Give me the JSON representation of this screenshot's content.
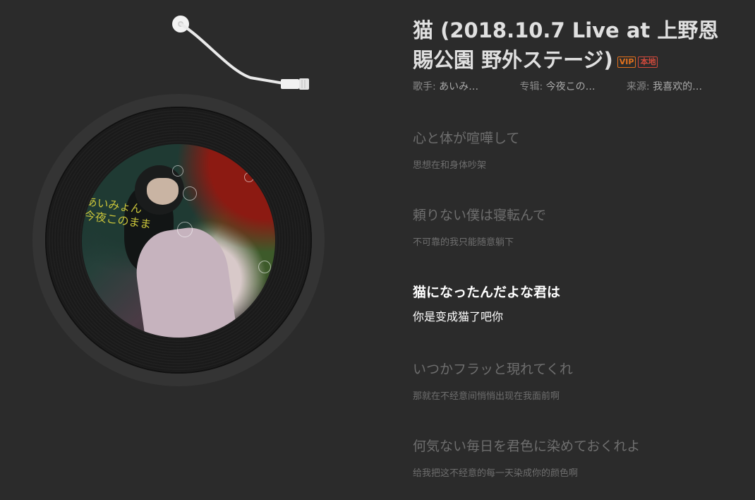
{
  "cover": {
    "caption": "あいみょん\n今夜このまま"
  },
  "song": {
    "title": "猫 (2018.10.7 Live at 上野恩賜公園 野外ステージ)",
    "badges": {
      "vip": "VIP",
      "local": "本地"
    },
    "singer_label": "歌手:",
    "singer": "あいみ…",
    "album_label": "专辑:",
    "album": "今夜この…",
    "source_label": "来源:",
    "source": "我喜欢的…"
  },
  "lyrics": [
    {
      "original": "心と体が喧嘩して",
      "translation": "思想在和身体吵架"
    },
    {
      "original": "頼りない僕は寝転んで",
      "translation": "不可靠的我只能随意躺下"
    },
    {
      "original": "猫になったんだよな君は",
      "translation": "你是变成猫了吧你"
    },
    {
      "original": "いつかフラッと現れてくれ",
      "translation": "那就在不经意间悄悄出现在我面前啊"
    },
    {
      "original": "何気ない毎日を君色に染めておくれよ",
      "translation": "给我把这不经意的每一天染成你的颜色啊"
    }
  ],
  "current_lyric_index": 2,
  "colors": {
    "background": "#2b2b2b",
    "lyric_active": "#ffffff",
    "lyric_inactive": "#6e6e6e",
    "vip_badge": "#e2711d",
    "local_badge": "#d24a3c"
  }
}
